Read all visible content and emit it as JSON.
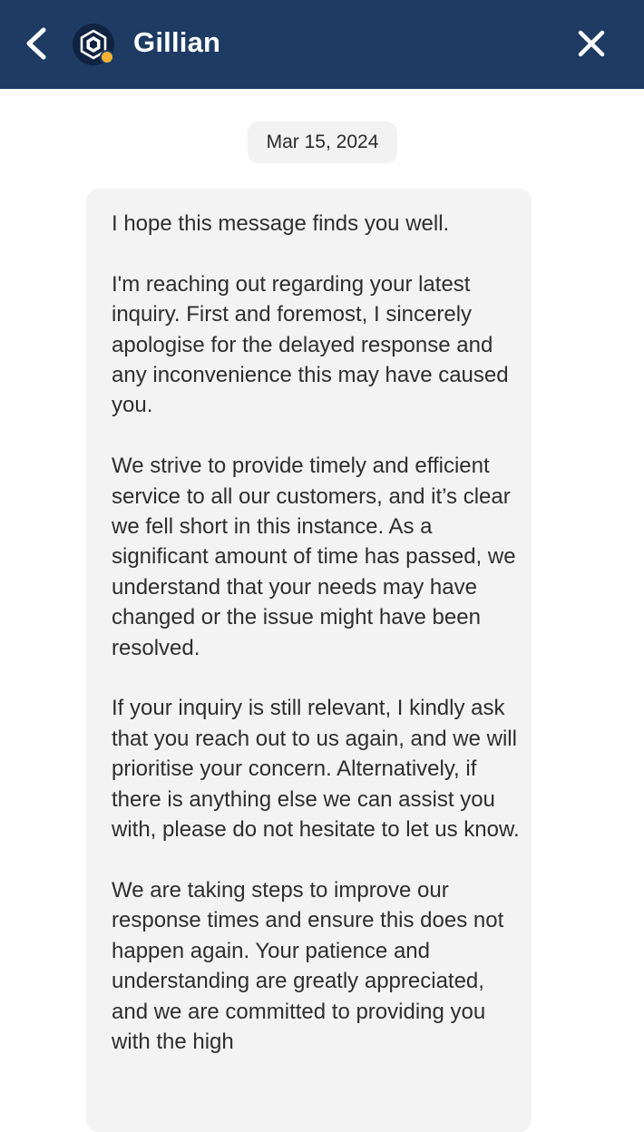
{
  "header": {
    "title": "Gillian",
    "back_icon": "chevron-left-icon",
    "close_icon": "close-icon",
    "avatar_icon": "crypto-com-logo-icon",
    "background_color": "#1d3b63",
    "presence_color": "#f2b233"
  },
  "conversation": {
    "date_label": "Mar 15, 2024",
    "message": {
      "paragraphs": [
        "I hope this message finds you well.",
        "I'm reaching out regarding your latest inquiry. First and foremost, I sincerely apologise for the delayed response and any inconvenience this may have caused you.",
        "We strive to provide timely and efficient service to all our customers, and it’s clear we fell short in this instance. As a significant amount of time has passed, we understand that your needs may have changed or the issue might have been resolved.",
        "If your inquiry is still relevant, I kindly ask that you reach out to us again, and we will prioritise your concern. Alternatively, if there is anything else we can assist you with, please do not hesitate to let us know.",
        "We are taking steps to improve our response times and ensure this does not happen again. Your patience and understanding are greatly appreciated, and we are committed to providing you with the high"
      ]
    }
  }
}
